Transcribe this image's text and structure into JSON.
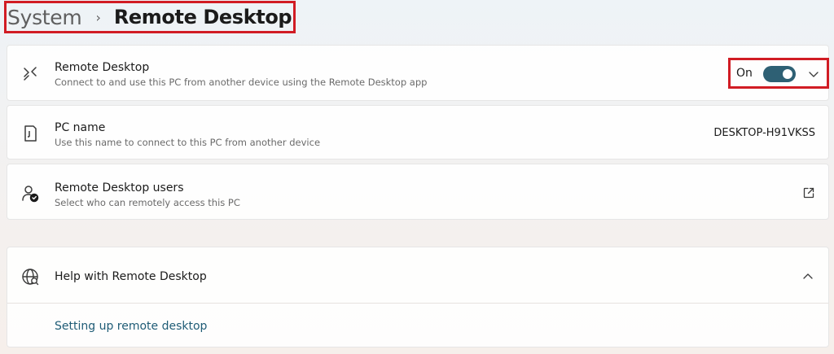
{
  "breadcrumb": {
    "parent": "System",
    "separator": "›",
    "current": "Remote Desktop"
  },
  "remote_desktop": {
    "icon": "remote-desktop-icon",
    "title": "Remote Desktop",
    "description": "Connect to and use this PC from another device using the Remote Desktop app",
    "toggle_label": "On",
    "toggle_on": true
  },
  "pc_name": {
    "icon": "pc-icon",
    "title": "PC name",
    "description": "Use this name to connect to this PC from another device",
    "value": "DESKTOP-H91VKSS"
  },
  "remote_users": {
    "icon": "users-icon",
    "title": "Remote Desktop users",
    "description": "Select who can remotely access this PC"
  },
  "help": {
    "icon": "globe-icon",
    "title": "Help with Remote Desktop",
    "link": "Setting up remote desktop"
  },
  "colors": {
    "accent": "#2e6074",
    "highlight_border": "#d11c24",
    "link": "#1f5c76"
  }
}
